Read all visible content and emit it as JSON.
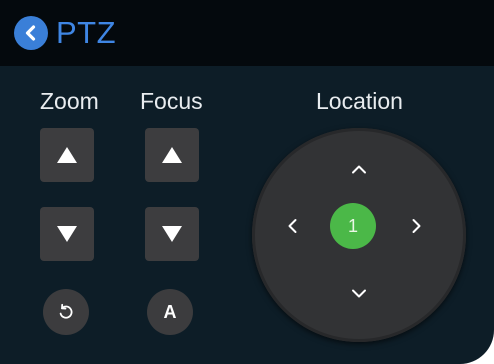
{
  "header": {
    "title": "PTZ",
    "back_icon": "chevron-left-icon"
  },
  "columns": {
    "zoom_label": "Zoom",
    "focus_label": "Focus",
    "location_label": "Location"
  },
  "zoom": {
    "in_icon": "triangle-up-icon",
    "out_icon": "triangle-down-icon",
    "reset_icon": "rotate-ccw-icon"
  },
  "focus": {
    "near_icon": "triangle-up-icon",
    "far_icon": "triangle-down-icon",
    "auto_label": "A"
  },
  "location": {
    "preset_number": "1",
    "up_icon": "chevron-up-icon",
    "down_icon": "chevron-down-icon",
    "left_icon": "chevron-left-icon",
    "right_icon": "chevron-right-icon"
  },
  "colors": {
    "accent": "#3f86e4",
    "panel_bg": "#0d1d27",
    "header_bg": "#04090d",
    "button_bg": "#3d3d3f",
    "preset_green": "#4bb848"
  }
}
